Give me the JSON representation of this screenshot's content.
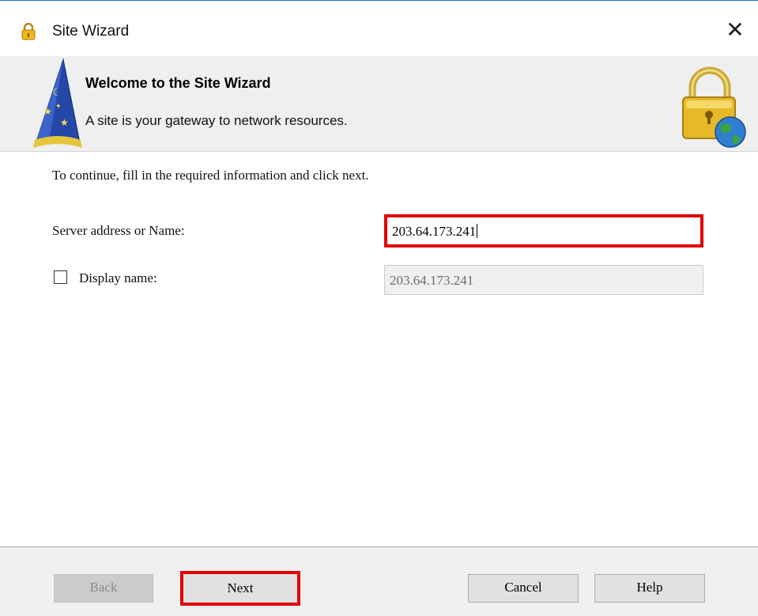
{
  "window": {
    "title": "Site Wizard",
    "close_icon": "close-icon"
  },
  "banner": {
    "title": "Welcome to the Site Wizard",
    "subtitle": "A site is your gateway to network resources.",
    "left_icon": "wizard-hat-icon",
    "right_icon": "lock-globe-icon"
  },
  "form": {
    "instructions": "To continue, fill in the required information and click next.",
    "server_label": "Server address or Name:",
    "server_value": "203.64.173.241",
    "display_label": "Display name:",
    "display_checked": false,
    "display_value": "203.64.173.241"
  },
  "buttons": {
    "back": "Back",
    "next": "Next",
    "cancel": "Cancel",
    "help": "Help"
  },
  "colors": {
    "highlight": "#e00000",
    "banner_bg": "#efefef",
    "footer_bg": "#f0f0f0"
  }
}
